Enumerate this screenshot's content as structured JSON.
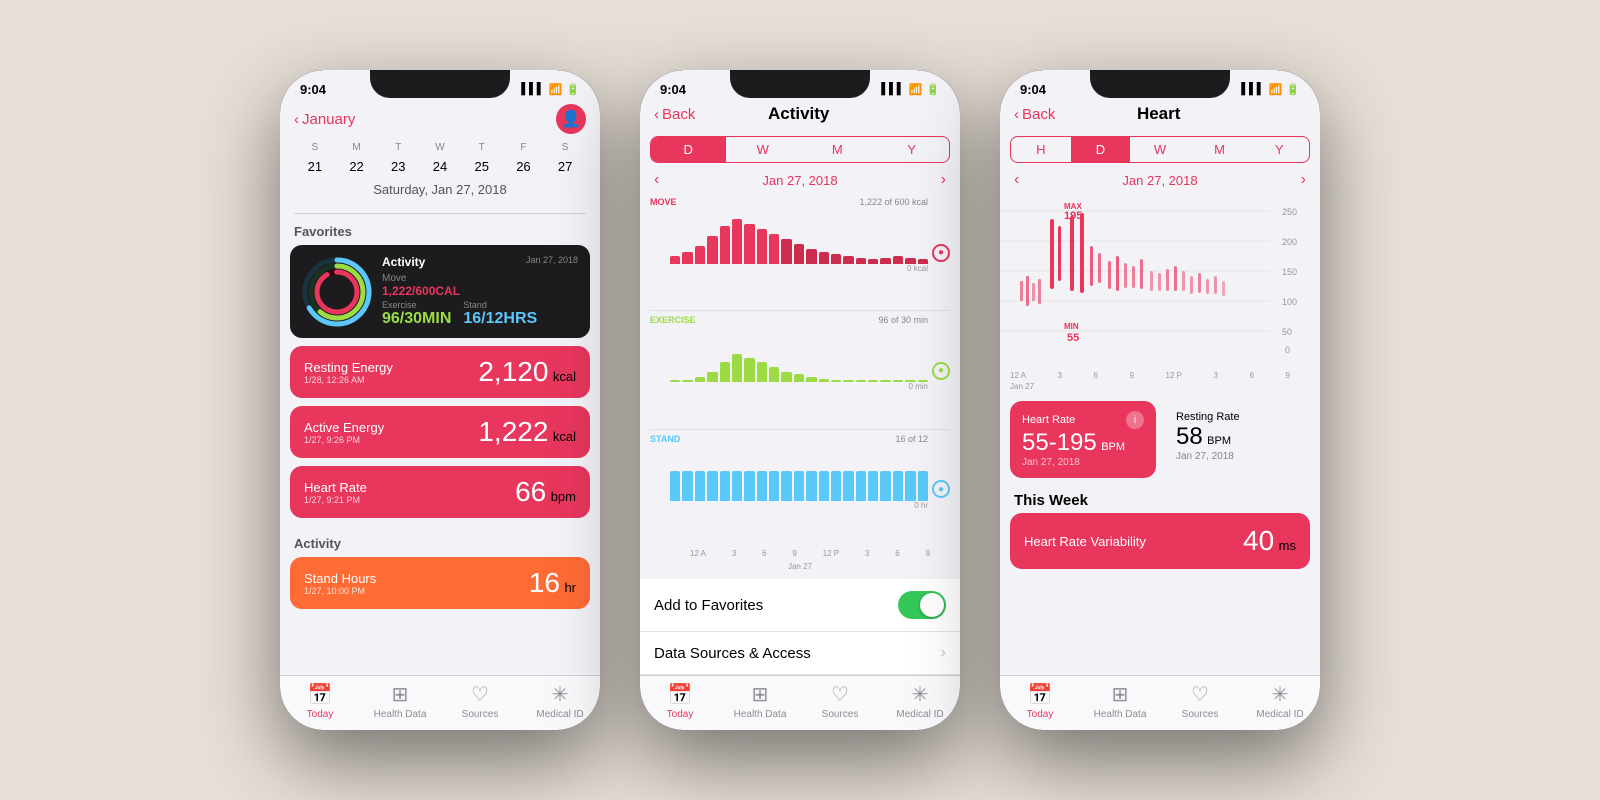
{
  "background": "#e8e0d8",
  "phones": [
    {
      "id": "phone1",
      "statusBar": {
        "time": "9:04",
        "signal": "▌▌▌",
        "wifi": "WiFi",
        "battery": "Battery"
      },
      "nav": {
        "back": "January",
        "title": "",
        "rightIcon": "person-circle"
      },
      "calendar": {
        "days": [
          "S",
          "M",
          "T",
          "W",
          "T",
          "F",
          "S"
        ],
        "dates": [
          "21",
          "22",
          "23",
          "24",
          "25",
          "26",
          "27"
        ],
        "dateLabel": "Saturday, Jan 27, 2018"
      },
      "sections": [
        {
          "title": "Favorites",
          "items": [
            {
              "type": "activity-ring",
              "title": "Activity",
              "date": "Jan 27, 2018",
              "move": "1,222/600CAL",
              "exercise": "96/30MIN",
              "stand": "16/12HRS"
            },
            {
              "type": "tile",
              "color": "red",
              "label": "Resting Energy",
              "value": "2,120",
              "unit": "kcal",
              "sub": "1/28, 12:26 AM"
            },
            {
              "type": "tile",
              "color": "red",
              "label": "Active Energy",
              "value": "1,222",
              "unit": "kcal",
              "sub": "1/27, 9:26 PM"
            },
            {
              "type": "tile",
              "color": "red",
              "label": "Heart Rate",
              "value": "66",
              "unit": "bpm",
              "sub": "1/27, 9:21 PM"
            }
          ]
        },
        {
          "title": "Activity",
          "items": [
            {
              "type": "tile",
              "color": "orange",
              "label": "Stand Hours",
              "value": "16",
              "unit": "hr",
              "sub": "1/27, 10:00 PM"
            }
          ]
        }
      ],
      "tabBar": [
        {
          "icon": "📅",
          "label": "Today",
          "active": true
        },
        {
          "icon": "⊞",
          "label": "Health Data",
          "active": false
        },
        {
          "icon": "♡",
          "label": "Sources",
          "active": false
        },
        {
          "icon": "✳",
          "label": "Medical ID",
          "active": false
        }
      ]
    },
    {
      "id": "phone2",
      "statusBar": {
        "time": "9:04"
      },
      "nav": {
        "back": "Back",
        "title": "Activity"
      },
      "segments": [
        "D",
        "W",
        "M",
        "Y"
      ],
      "activeSegment": "D",
      "chartDate": "Jan 27, 2018",
      "sections": [
        {
          "label": "MOVE",
          "color": "red",
          "info": "1,222 of 600 kcal",
          "iconBg": "#e8365d",
          "barColor": "#e8365d",
          "bars": [
            5,
            8,
            12,
            18,
            25,
            35,
            45,
            40,
            38,
            30,
            25,
            20,
            15,
            10,
            8,
            5,
            4,
            6,
            8,
            10,
            8,
            6,
            5
          ]
        },
        {
          "label": "EXERCISE",
          "color": "green",
          "info": "96 of 30 min",
          "iconBg": "#9cdb43",
          "barColor": "#9cdb43",
          "bars": [
            0,
            0,
            0,
            5,
            10,
            18,
            25,
            22,
            20,
            15,
            10,
            8,
            5,
            3,
            2,
            0,
            0,
            0,
            0,
            0,
            0,
            0,
            0
          ]
        },
        {
          "label": "STAND",
          "color": "cyan",
          "info": "16 of 12",
          "iconBg": "#5ac8fa",
          "barColor": "#5ac8fa",
          "bars": [
            8,
            8,
            8,
            8,
            8,
            8,
            8,
            8,
            8,
            8,
            8,
            8,
            8,
            8,
            8,
            8,
            8,
            8,
            8,
            8,
            8,
            8,
            8
          ]
        }
      ],
      "timeLabels": [
        "12 A",
        "3",
        "6",
        "9",
        "12 P",
        "3",
        "6",
        "9"
      ],
      "settings": [
        {
          "label": "Add to Favorites",
          "type": "toggle",
          "value": true
        },
        {
          "label": "Data Sources & Access",
          "type": "arrow"
        }
      ],
      "tabBar": [
        {
          "icon": "📅",
          "label": "Today",
          "active": true
        },
        {
          "icon": "⊞",
          "label": "Health Data",
          "active": false
        },
        {
          "icon": "♡",
          "label": "Sources",
          "active": false
        },
        {
          "icon": "✳",
          "label": "Medical ID",
          "active": false
        }
      ]
    },
    {
      "id": "phone3",
      "statusBar": {
        "time": "9:04"
      },
      "nav": {
        "back": "Back",
        "title": "Heart"
      },
      "segments": [
        "H",
        "D",
        "W",
        "M",
        "Y"
      ],
      "activeSegment": "D",
      "chartDate": "Jan 27, 2018",
      "heartStats": {
        "max": 195,
        "min": 55,
        "maxLabel": "MAX\n195",
        "minLabel": "MIN\n55"
      },
      "yAxisLabels": [
        "250",
        "200",
        "150",
        "100",
        "50",
        "0"
      ],
      "timeLabels": [
        "12 A",
        "3",
        "6",
        "9",
        "12 P",
        "3",
        "6",
        "9"
      ],
      "cards": [
        {
          "label": "Heart Rate",
          "value": "55-195",
          "unit": "BPM",
          "date": "Jan 27, 2018",
          "color": "red"
        },
        {
          "label": "Resting Rate",
          "value": "58",
          "unit": "BPM",
          "date": "Jan 27, 2018",
          "color": "gray"
        }
      ],
      "thisWeek": "This Week",
      "hrv": {
        "label": "Heart Rate Variability",
        "value": "40",
        "unit": "ms"
      },
      "tabBar": [
        {
          "icon": "📅",
          "label": "Today",
          "active": true
        },
        {
          "icon": "⊞",
          "label": "Health Data",
          "active": false
        },
        {
          "icon": "♡",
          "label": "Sources",
          "active": false
        },
        {
          "icon": "✳",
          "label": "Medical ID",
          "active": false
        }
      ]
    }
  ]
}
